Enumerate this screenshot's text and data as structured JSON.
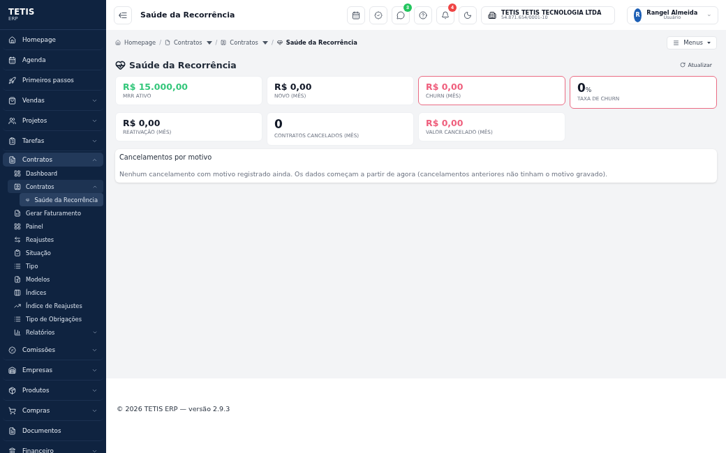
{
  "sidebar": {
    "logo": {
      "name": "TETIS",
      "subtitle": "ERP"
    },
    "items": [
      {
        "label": "Homepage",
        "expandable": false,
        "selected": false
      },
      {
        "label": "Agenda",
        "expandable": false,
        "selected": false
      },
      {
        "label": "Primeiros passos",
        "expandable": false,
        "selected": false
      },
      {
        "label": "Vendas",
        "expandable": true,
        "expanded": false,
        "selected": false
      },
      {
        "label": "Projetos",
        "expandable": true,
        "expanded": false,
        "selected": false
      },
      {
        "label": "Tarefas",
        "expandable": true,
        "expanded": false,
        "selected": false
      },
      {
        "label": "Contratos",
        "expandable": true,
        "expanded": true,
        "selected": true,
        "children": [
          {
            "label": "Dashboard",
            "expandable": false,
            "selected": false
          },
          {
            "label": "Contratos",
            "expandable": true,
            "expanded": true,
            "selected": true,
            "children": [
              {
                "label": "Saúde da Recorrência",
                "selected": true
              }
            ]
          },
          {
            "label": "Gerar Faturamento",
            "expandable": false,
            "selected": false
          },
          {
            "label": "Painel",
            "expandable": false,
            "selected": false
          },
          {
            "label": "Reajustes",
            "expandable": false,
            "selected": false
          },
          {
            "label": "Situação",
            "expandable": false,
            "selected": false
          },
          {
            "label": "Tipo",
            "expandable": false,
            "selected": false
          },
          {
            "label": "Modelos",
            "expandable": false,
            "selected": false
          },
          {
            "label": "Índices",
            "expandable": false,
            "selected": false
          },
          {
            "label": "Índice de Reajustes",
            "expandable": false,
            "selected": false
          },
          {
            "label": "Tipo de Obrigações",
            "expandable": false,
            "selected": false
          },
          {
            "label": "Relatórios",
            "expandable": true,
            "expanded": false,
            "selected": false
          }
        ]
      },
      {
        "label": "Comissões",
        "expandable": true,
        "expanded": false,
        "selected": false
      },
      {
        "label": "Empresas",
        "expandable": true,
        "expanded": false,
        "selected": false
      },
      {
        "label": "Produtos",
        "expandable": true,
        "expanded": false,
        "selected": false
      },
      {
        "label": "Compras",
        "expandable": true,
        "expanded": false,
        "selected": false
      },
      {
        "label": "Documentos",
        "expandable": false,
        "selected": false
      },
      {
        "label": "Financeiro",
        "expandable": true,
        "expanded": false,
        "selected": false
      }
    ]
  },
  "header": {
    "title": "Saúde da Recorrência",
    "badges": [
      {
        "count": "3",
        "color": "#22c55e"
      },
      {
        "count": "4",
        "color": "#ef4444"
      }
    ],
    "company": {
      "name": "TETIS TETIS TECNOLOGIA LTDA",
      "document": "54.871.654/0001-10"
    },
    "user": {
      "initial": "R",
      "name": "Rangel Almeida",
      "role": "Usuário"
    }
  },
  "breadcrumb": {
    "separator": "/",
    "items": [
      {
        "label": "Homepage",
        "dropdown": false,
        "current": false
      },
      {
        "label": "Contratos",
        "dropdown": true,
        "current": false
      },
      {
        "label": "Contratos",
        "dropdown": true,
        "current": false
      },
      {
        "label": "Saúde da Recorrência",
        "dropdown": false,
        "current": true
      }
    ]
  },
  "menus_button": "Menus",
  "page": {
    "title": "Saúde da Recorrência",
    "refresh_button": "Atualizar",
    "cards": [
      {
        "value": "R$ 15.000,00",
        "label": "MRR ATIVO",
        "color": "#34c77b",
        "highlighted": false,
        "kind": "money"
      },
      {
        "value": "R$ 0,00",
        "label": "NOVO (MÊS)",
        "color": "#111827",
        "highlighted": false,
        "kind": "money"
      },
      {
        "value": "R$ 0,00",
        "label": "CHURN (MÊS)",
        "color": "#ef5f7d",
        "highlighted": true,
        "kind": "money"
      },
      {
        "value": "0",
        "unit": "%",
        "label": "TAXA DE CHURN",
        "color": "#111827",
        "highlighted": true,
        "kind": "count"
      },
      {
        "value": "R$ 0,00",
        "label": "REATIVAÇÃO (MÊS)",
        "color": "#111827",
        "highlighted": false,
        "kind": "money"
      },
      {
        "value": "0",
        "label": "CONTRATOS CANCELADOS (MÊS)",
        "color": "#111827",
        "highlighted": false,
        "kind": "count"
      },
      {
        "value": "R$ 0,00",
        "label": "VALOR CANCELADO (MÊS)",
        "color": "#ef5f7d",
        "highlighted": false,
        "kind": "money"
      }
    ],
    "panel": {
      "title": "Cancelamentos por motivo",
      "message": "Nenhum cancelamento com motivo registrado ainda. Os dados começam a partir de agora (cancelamentos anteriores não tinham o motivo gravado)."
    }
  },
  "footer": "© 2026 TETIS ERP — versão 2.9.3"
}
